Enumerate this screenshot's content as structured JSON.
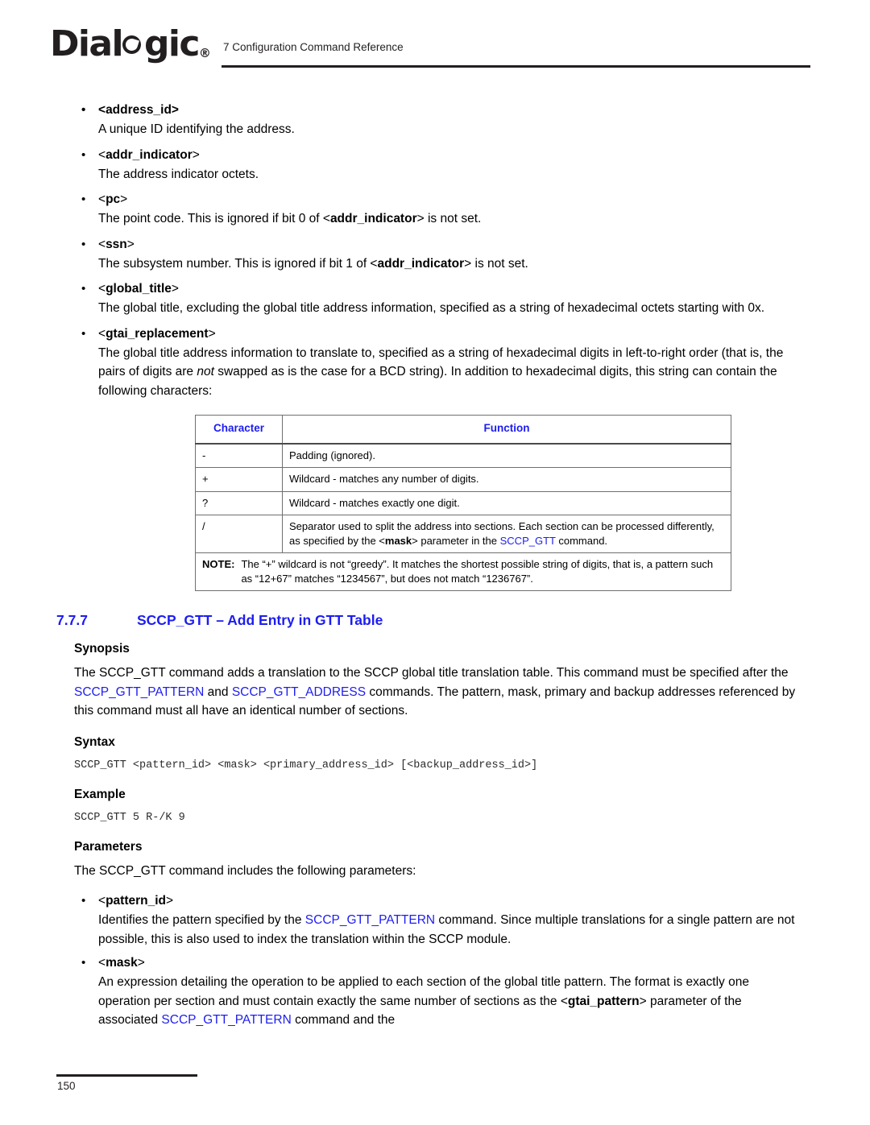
{
  "header": {
    "logo_text": "Dial",
    "logo_text_tail": "gic",
    "logo_reg": "®",
    "title": "7 Configuration Command Reference"
  },
  "footer": {
    "page_number": "150"
  },
  "colors": {
    "link": "#1d1df0",
    "heading": "#1d1df0",
    "text": "#000000",
    "table_border": "#6f6f6f"
  },
  "address_params": [
    {
      "term_prefix": "<",
      "term": "address_id",
      "term_suffix": ">",
      "all_bold": true,
      "desc": "A unique ID identifying the address."
    },
    {
      "term_prefix": "<",
      "term": "addr_indicator",
      "term_suffix": ">",
      "all_bold": false,
      "desc": "The address indicator octets."
    },
    {
      "term_prefix": "<",
      "term": "pc",
      "term_suffix": ">",
      "all_bold": false,
      "desc_pre": "The point code. This is ignored if bit 0 of <",
      "desc_bold": "addr_indicator",
      "desc_post": "> is not set."
    },
    {
      "term_prefix": "<",
      "term": "ssn",
      "term_suffix": ">",
      "all_bold": false,
      "desc_pre": "The subsystem number. This is ignored if bit 1 of <",
      "desc_bold": "addr_indicator",
      "desc_post": "> is not set."
    },
    {
      "term_prefix": "<",
      "term": "global_title",
      "term_suffix": ">",
      "all_bold": false,
      "desc": "The global title, excluding the global title address information, specified as a string of hexadecimal octets starting with 0x."
    },
    {
      "term_prefix": "<",
      "term": "gtai_replacement",
      "term_suffix": ">",
      "all_bold": false,
      "desc_pre": "The global title address information to translate to, specified as a string of hexadecimal digits in left-to-right order (that is, the pairs of digits are ",
      "desc_italic": "not",
      "desc_post": " swapped as is the case for a BCD string). In addition to hexadecimal digits, this string can contain the following characters:"
    }
  ],
  "char_table": {
    "headers": [
      "Character",
      "Function"
    ],
    "rows": [
      {
        "character": "-",
        "function": "Padding (ignored)."
      },
      {
        "character": "+",
        "function": "Wildcard - matches any number of digits."
      },
      {
        "character": "?",
        "function": "Wildcard - matches exactly one digit."
      },
      {
        "character": "/",
        "function_pre": "Separator used to split the address into sections. Each section can be processed differently, as specified by the <",
        "function_bold": "mask",
        "function_mid": "> parameter in the ",
        "function_link": "SCCP_GTT",
        "function_post": " command."
      }
    ],
    "note_label": "NOTE:",
    "note_text": "The “+” wildcard is not “greedy”. It matches the shortest possible string of digits, that is, a pattern such as “12+67” matches “1234567”, but does not match “1236767”."
  },
  "section": {
    "number": "7.7.7",
    "title": "SCCP_GTT – Add Entry in GTT Table",
    "synopsis_label": "Synopsis",
    "synopsis_pre": "The SCCP_GTT command adds a translation to the SCCP global title translation table. This command must be specified after the ",
    "synopsis_link1": "SCCP_GTT_PATTERN",
    "synopsis_mid": " and ",
    "synopsis_link2": "SCCP_GTT_ADDRESS",
    "synopsis_post": " commands. The pattern, mask, primary and backup addresses referenced by this command must all have an identical number of sections.",
    "syntax_label": "Syntax",
    "syntax_code": "SCCP_GTT <pattern_id> <mask> <primary_address_id> [<backup_address_id>]",
    "example_label": "Example",
    "example_code": "SCCP_GTT 5 R-/K 9",
    "parameters_label": "Parameters",
    "parameters_intro": "The SCCP_GTT command includes the following parameters:"
  },
  "command_params": [
    {
      "term_prefix": "<",
      "term": "pattern_id",
      "term_suffix": ">",
      "desc_pre": "Identifies the pattern specified by the ",
      "desc_link": "SCCP_GTT_PATTERN",
      "desc_post": " command. Since multiple translations for a single pattern are not possible, this is also used to index the translation within the SCCP module."
    },
    {
      "term_prefix": "<",
      "term": "mask",
      "term_suffix": ">",
      "desc_pre": "An expression detailing the operation to be applied to each section of the global title pattern. The format is exactly one operation per section and must contain exactly the same number of sections as the <",
      "desc_bold": "gtai_pattern",
      "desc_mid": "> parameter of the associated ",
      "desc_link": "SCCP_GTT_PATTERN",
      "desc_post": " command and the"
    }
  ],
  "icons": {
    "bullet": "bullet-dot-icon"
  }
}
